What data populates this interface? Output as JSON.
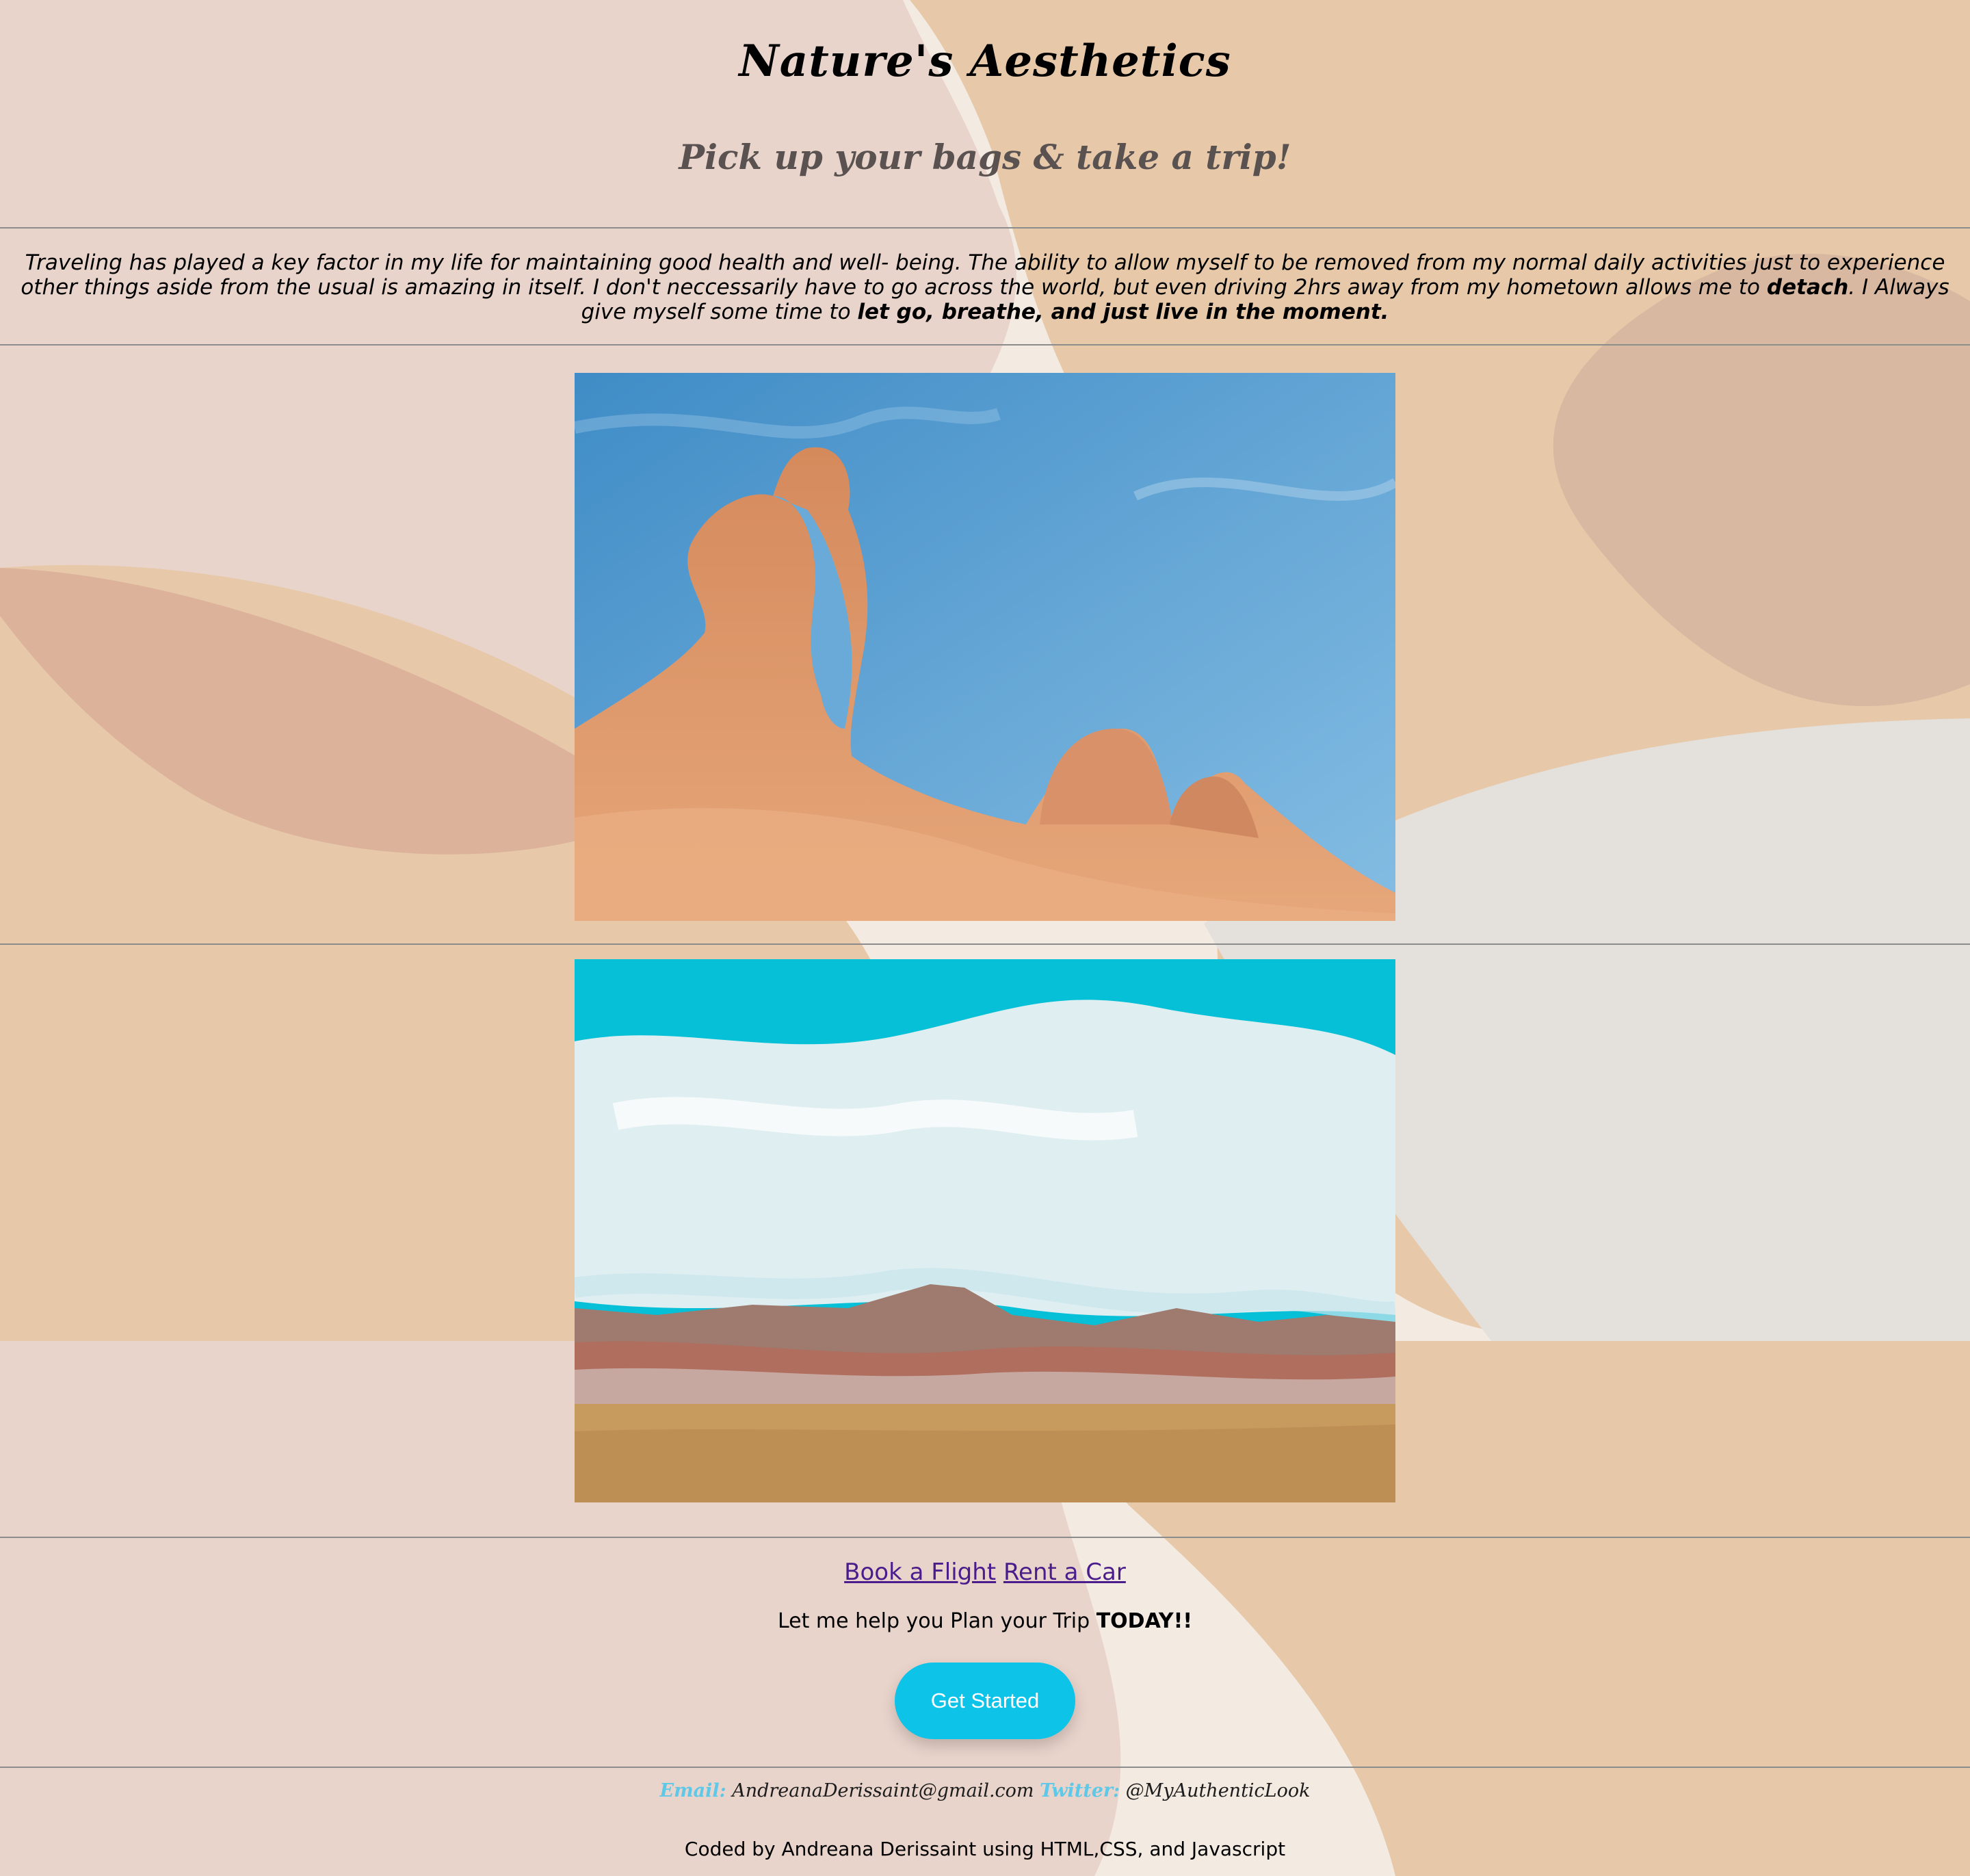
{
  "header": {
    "title": "Nature's Aesthetics",
    "subtitle": "Pick up your bags & take a trip!"
  },
  "intro": {
    "part1": "Traveling has played a key factor in my life for maintaining good health and well- being. The ability to allow myself to be removed from my normal daily activities just to experience other things aside from the usual is amazing in itself. I don't neccessarily have to go across the world, but even driving 2hrs away from my hometown allows me to ",
    "bold1": "detach",
    "part2": ". I Always give myself some time to ",
    "bold2": "let go, breathe, and just live in the moment."
  },
  "images": [
    {
      "alt": "Red sandstone arch under a blue sky"
    },
    {
      "alt": "Painted desert badlands under a cloudy turquoise sky"
    }
  ],
  "links": {
    "book_flight": "Book a Flight",
    "rent_car": "Rent a Car"
  },
  "cta": {
    "text": "Let me help you Plan your Trip ",
    "bold": "TODAY!!",
    "button_label": "Get Started"
  },
  "contact": {
    "email_label": "Email:",
    "email_value": "AndreanaDerissaint@gmail.com",
    "twitter_label": "Twitter:",
    "twitter_value": "@MyAuthenticLook"
  },
  "footer": {
    "credit": "Coded by Andreana Derissaint using HTML,CSS, and Javascript"
  },
  "colors": {
    "page_bg": "#e9d4cb",
    "accent_button": "#0ec3e8",
    "link": "#4b1d8c",
    "contact_label": "#5ec8e8"
  }
}
